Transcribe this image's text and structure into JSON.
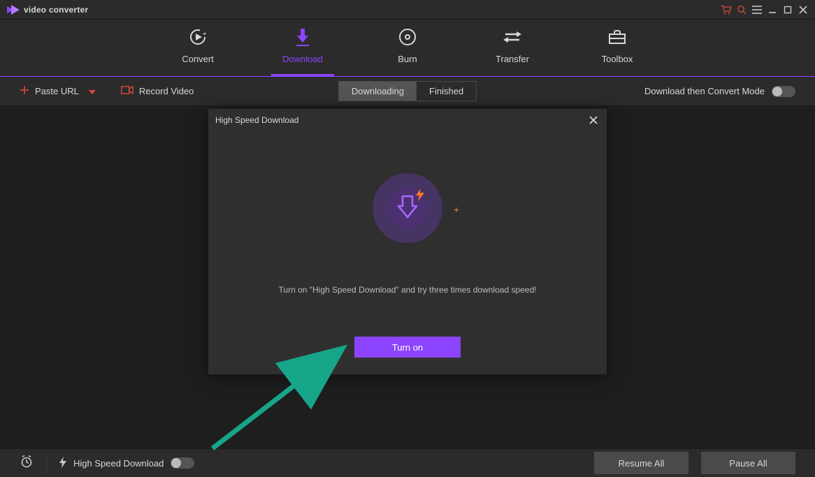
{
  "app": {
    "name": "video converter"
  },
  "window_controls": {
    "cart": "cart-icon",
    "search": "search-icon",
    "menu": "menu-icon",
    "min": "minimize-icon",
    "max": "maximize-icon",
    "close": "close-icon"
  },
  "main_tabs": [
    {
      "id": "convert",
      "label": "Convert"
    },
    {
      "id": "download",
      "label": "Download",
      "active": true
    },
    {
      "id": "burn",
      "label": "Burn"
    },
    {
      "id": "transfer",
      "label": "Transfer"
    },
    {
      "id": "toolbox",
      "label": "Toolbox"
    }
  ],
  "toolbar": {
    "paste_url": "Paste URL",
    "record_video": "Record Video",
    "segments": [
      {
        "id": "downloading",
        "label": "Downloading",
        "active": true
      },
      {
        "id": "finished",
        "label": "Finished"
      }
    ],
    "convert_mode_label": "Download then Convert Mode",
    "convert_mode_on": false
  },
  "modal": {
    "title": "High Speed Download",
    "message": "Turn on \"High Speed Download\" and try three times download speed!",
    "button_label": "Turn on"
  },
  "footer": {
    "hsd_label": "High Speed Download",
    "hsd_on": false,
    "resume_label": "Resume All",
    "pause_label": "Pause All"
  }
}
